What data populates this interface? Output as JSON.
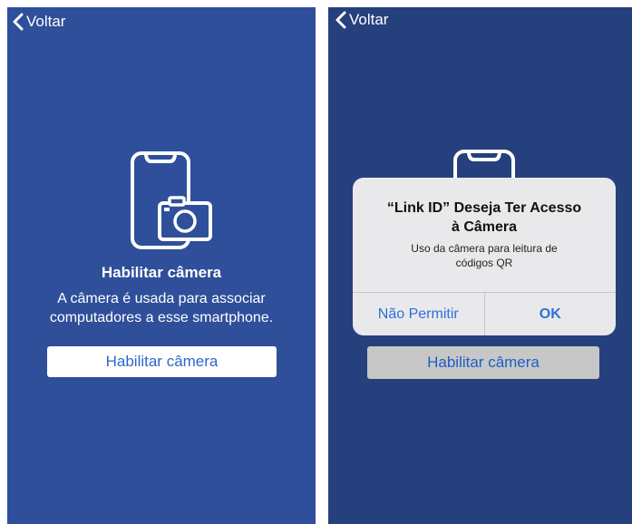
{
  "colors": {
    "left_background": "#2f4f9a",
    "right_background": "#26407d",
    "accent_blue": "#2f6fd6",
    "alert_background": "#e9e9ec",
    "disabled_button": "#c7c7c7"
  },
  "left_screen": {
    "back_label": "Voltar",
    "icon": "phone-camera-icon",
    "title": "Habilitar câmera",
    "description_line1": "A câmera é usada para associar",
    "description_line2": "computadores a esse smartphone.",
    "button_label": "Habilitar câmera"
  },
  "right_screen": {
    "back_label": "Voltar",
    "icon": "phone-icon",
    "button_label": "Habilitar câmera",
    "alert": {
      "title_line1": "“Link ID” Deseja Ter Acesso",
      "title_line2": "à Câmera",
      "message_line1": "Uso da câmera para leitura de",
      "message_line2": "códigos QR",
      "deny_label": "Não Permitir",
      "ok_label": "OK"
    }
  }
}
